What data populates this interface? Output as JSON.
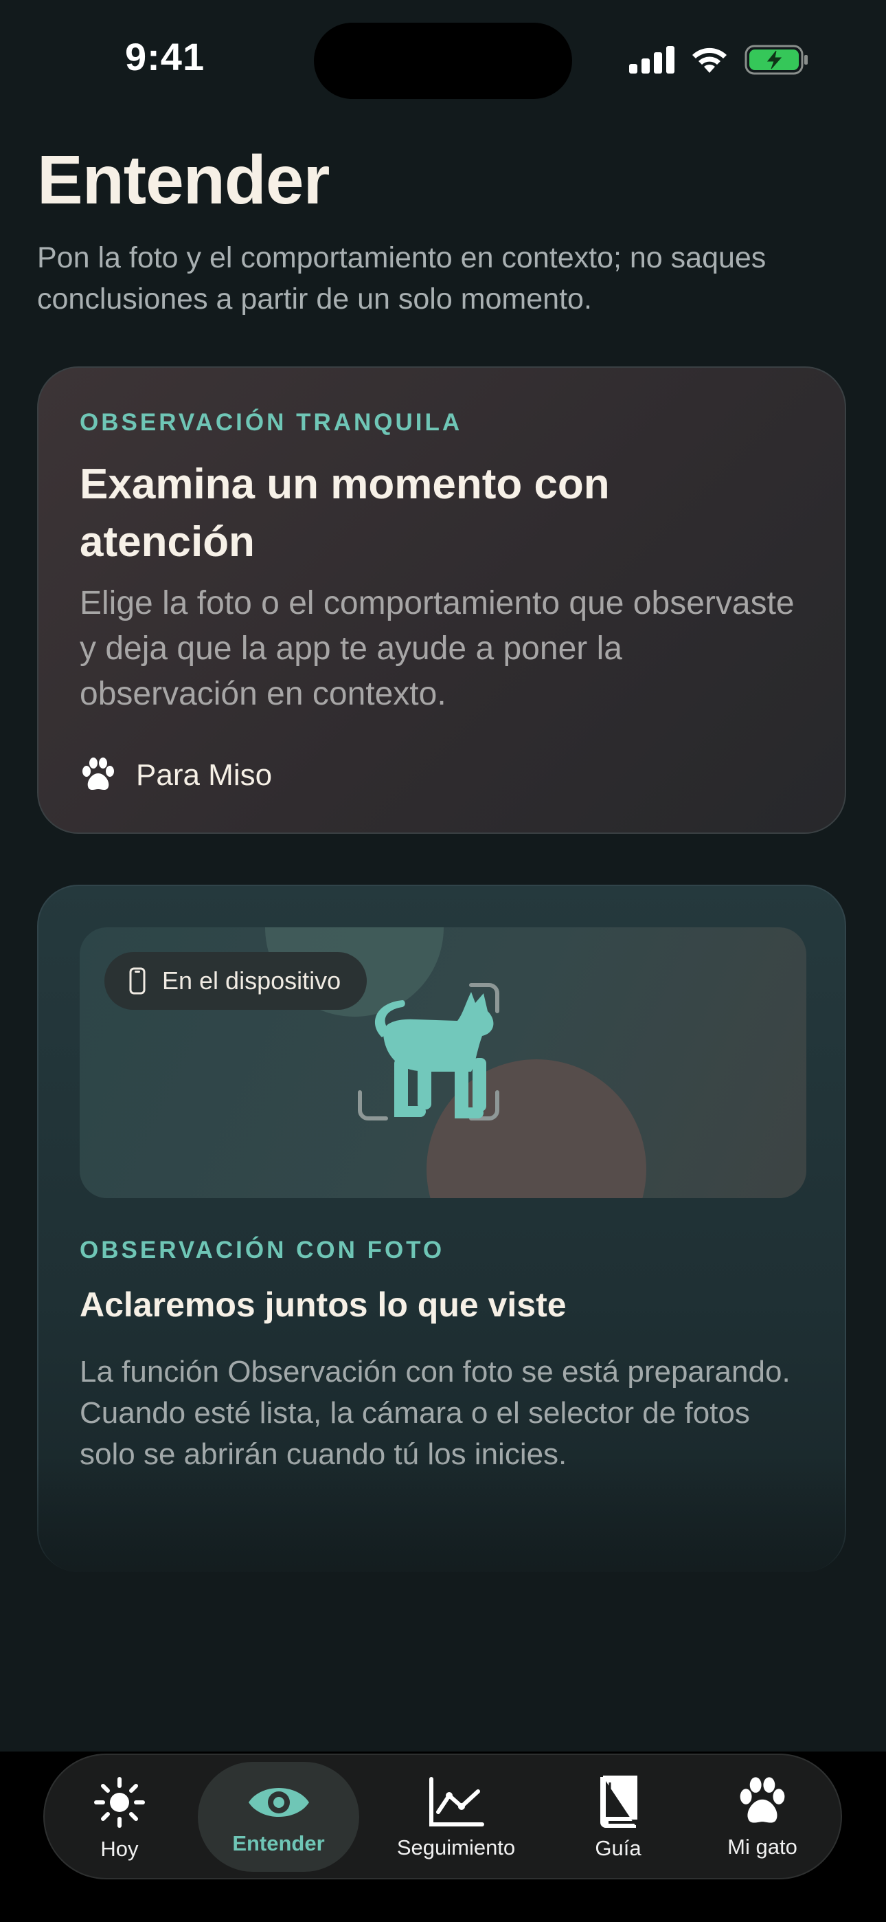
{
  "status_bar": {
    "time": "9:41"
  },
  "header": {
    "title": "Entender",
    "subtitle": "Pon la foto y el comportamiento en contexto; no saques conclusiones a partir de un solo momento."
  },
  "quiet_card": {
    "eyebrow": "OBSERVACIÓN TRANQUILA",
    "title": "Examina un momento con atención",
    "body": "Elige la foto o el comportamiento que observaste y deja que la app te ayude a poner la observación en contexto.",
    "for_label": "Para Miso",
    "for_icon": "paw-icon"
  },
  "photo_card": {
    "badge": "En el dispositivo",
    "badge_icon": "phone-icon",
    "art_icon": "cat-icon",
    "eyebrow": "OBSERVACIÓN CON FOTO",
    "title": "Aclaremos juntos lo que viste",
    "body": "La función Observación con foto se está preparando. Cuando esté lista, la cámara o el selector de fotos solo se abrirán cuando tú los inicies."
  },
  "tabs": [
    {
      "label": "Hoy",
      "icon": "sun-icon",
      "active": false
    },
    {
      "label": "Entender",
      "icon": "eye-icon",
      "active": true
    },
    {
      "label": "Seguimiento",
      "icon": "chart-icon",
      "active": false
    },
    {
      "label": "Guía",
      "icon": "book-icon",
      "active": false
    },
    {
      "label": "Mi gato",
      "icon": "paw-icon",
      "active": false
    }
  ],
  "colors": {
    "accent": "#6fc6b6",
    "background": "#121a1c",
    "battery": "#35c759"
  }
}
